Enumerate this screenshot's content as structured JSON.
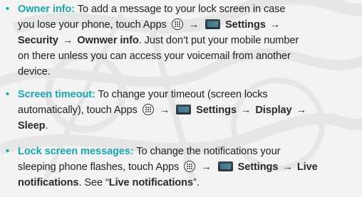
{
  "items": [
    {
      "term": "Owner info:",
      "lines": [
        "To add a message to your lock screen in case",
        "you lose your phone, touch Apps",
        "Settings",
        "Security",
        "Ownwer info",
        ". Just don’t put your mobile number",
        "on there unless you can access your voicemail from another",
        "device."
      ]
    },
    {
      "term": "Screen timeout:",
      "lines": [
        "To change your timeout (screen locks",
        "automatically), touch Apps",
        "Settings",
        "Display",
        "Sleep",
        "."
      ]
    },
    {
      "term": "Lock screen messages:",
      "lines": [
        "To change the notifications your",
        "sleeping phone flashes, touch Apps",
        "Settings",
        "Live",
        "notifications",
        ". See “",
        "Live notifications",
        "”."
      ]
    }
  ],
  "symbols": {
    "bullet": "•",
    "arrow": "→"
  },
  "colors": {
    "accent": "#19a7b4",
    "text": "#222222",
    "background": "#f3f3f3"
  },
  "icons": [
    "apps-icon",
    "settings-icon"
  ]
}
